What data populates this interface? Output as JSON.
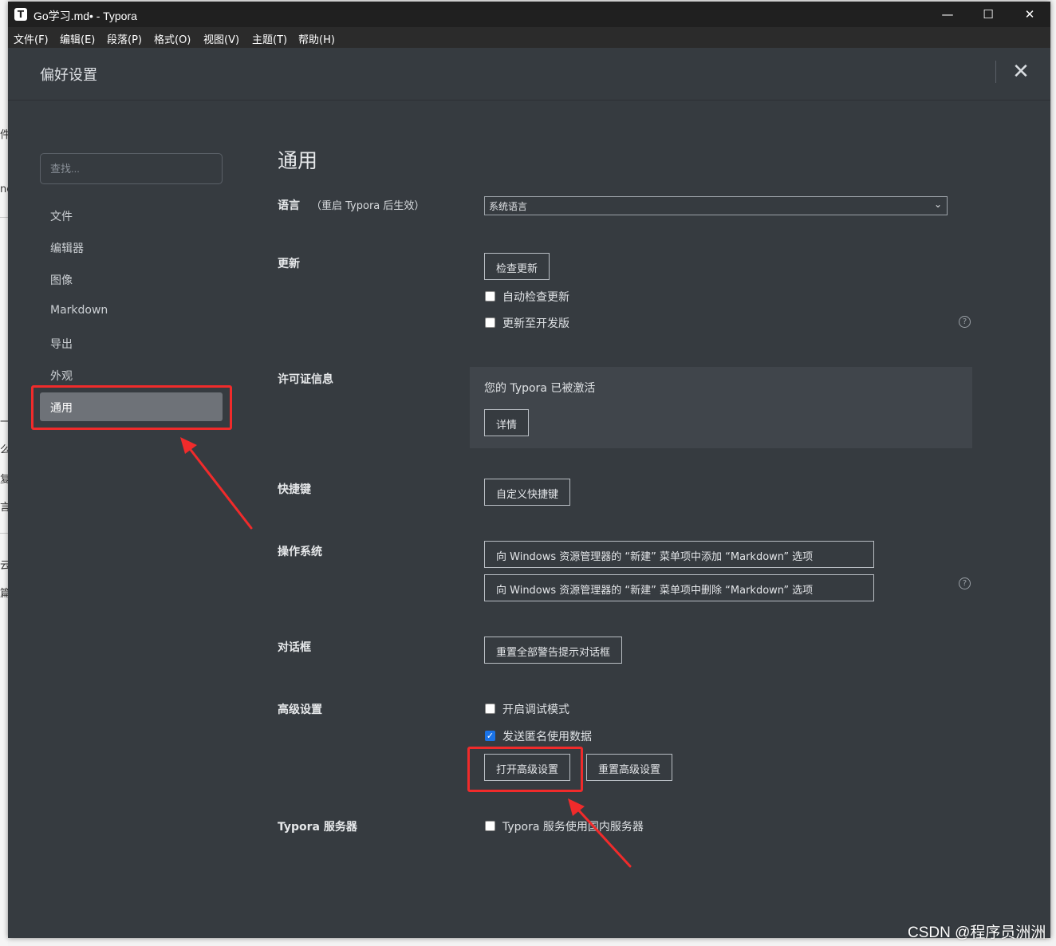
{
  "window": {
    "app_icon": "T",
    "title": "Go学习.md• - Typora",
    "minimize_glyph": "—",
    "maximize_glyph": "☐",
    "close_glyph": "✕"
  },
  "menubar": {
    "items": [
      "文件(F)",
      "编辑(E)",
      "段落(P)",
      "格式(O)",
      "视图(V)",
      "主题(T)",
      "帮助(H)"
    ]
  },
  "preferences": {
    "title": "偏好设置",
    "close_glyph": "✕",
    "search_placeholder": "查找...",
    "nav": [
      "文件",
      "编辑器",
      "图像",
      "Markdown",
      "导出",
      "外观",
      "通用"
    ],
    "active_nav": "通用"
  },
  "general": {
    "title": "通用",
    "language": {
      "label": "语言",
      "note": "（重启 Typora 后生效）",
      "selected": "系统语言",
      "chevron": "⌄"
    },
    "update": {
      "label": "更新",
      "check_button": "检查更新",
      "auto_check": {
        "label": "自动检查更新",
        "checked": false
      },
      "dev_channel": {
        "label": "更新至开发版",
        "checked": false
      }
    },
    "license": {
      "label": "许可证信息",
      "status": "您的 Typora 已被激活",
      "details_button": "详情"
    },
    "shortcuts": {
      "label": "快捷键",
      "customize_button": "自定义快捷键"
    },
    "os": {
      "label": "操作系统",
      "add_button": "向 Windows 资源管理器的 “新建” 菜单项中添加 “Markdown” 选项",
      "remove_button": "向 Windows 资源管理器的 “新建” 菜单项中删除 “Markdown” 选项"
    },
    "dialogs": {
      "label": "对话框",
      "reset_button": "重置全部警告提示对话框"
    },
    "advanced": {
      "label": "高级设置",
      "debug_mode": {
        "label": "开启调试模式",
        "checked": false
      },
      "send_anonymous": {
        "label": "发送匿名使用数据",
        "checked": true
      },
      "open_button": "打开高级设置",
      "reset_button": "重置高级设置"
    },
    "server": {
      "label": "Typora 服务器",
      "domestic": {
        "label": "Typora 服务使用国内服务器",
        "checked": false
      }
    },
    "help_glyph": "?"
  },
  "background": {
    "glyphs": [
      "件",
      "nc",
      "一体",
      "么打",
      "复杂",
      "言(",
      "云",
      "篇"
    ]
  },
  "watermark": "CSDN @程序员洲洲",
  "colors": {
    "highlight": "#f02b2b",
    "checkbox_checked": "#1a73e8",
    "panel_bg": "#363b40"
  }
}
